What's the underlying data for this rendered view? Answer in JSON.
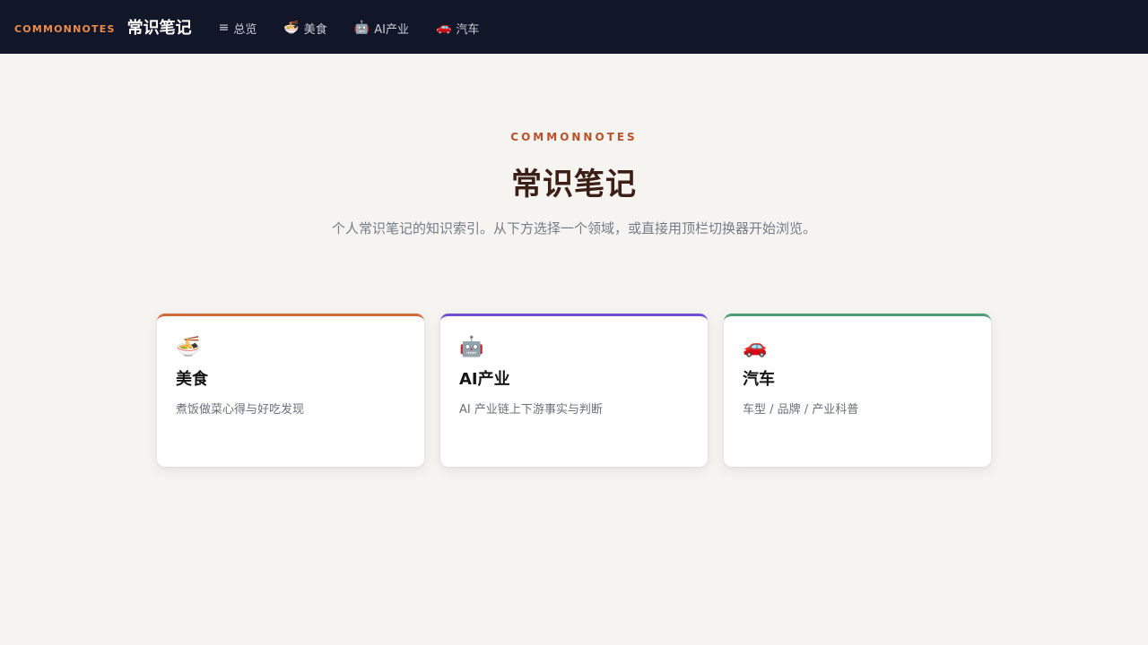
{
  "header": {
    "brand_en": "COMMONNOTES",
    "brand_zh": "常识笔记",
    "nav": [
      {
        "icon": "≡",
        "icon_name": "menu-icon",
        "label": "总览"
      },
      {
        "icon": "🍜",
        "icon_name": "noodle-bowl-icon",
        "label": "美食"
      },
      {
        "icon": "🤖",
        "icon_name": "robot-icon",
        "label": "AI产业"
      },
      {
        "icon": "🚗",
        "icon_name": "car-icon",
        "label": "汽车"
      }
    ]
  },
  "hero": {
    "eyebrow": "COMMONNOTES",
    "title": "常识笔记",
    "description": "个人常识笔记的知识索引。从下方选择一个领域，或直接用顶栏切换器开始浏览。"
  },
  "cards": [
    {
      "icon": "🍜",
      "icon_name": "noodle-bowl-icon",
      "title": "美食",
      "desc": "煮饭做菜心得与好吃发现",
      "accent": "#d2693a"
    },
    {
      "icon": "🤖",
      "icon_name": "robot-icon",
      "title": "AI产业",
      "desc": "AI 产业链上下游事实与判断",
      "accent": "#6d4fd0"
    },
    {
      "icon": "🚗",
      "icon_name": "car-icon",
      "title": "汽车",
      "desc": "车型 / 品牌 / 产业科普",
      "accent": "#4f9a78"
    }
  ],
  "colors": {
    "topbar_bg": "#111628",
    "brand_accent": "#ee8a4a",
    "page_bg": "#f5f4f1",
    "eyebrow": "#b8502a",
    "title": "#3c2016"
  }
}
